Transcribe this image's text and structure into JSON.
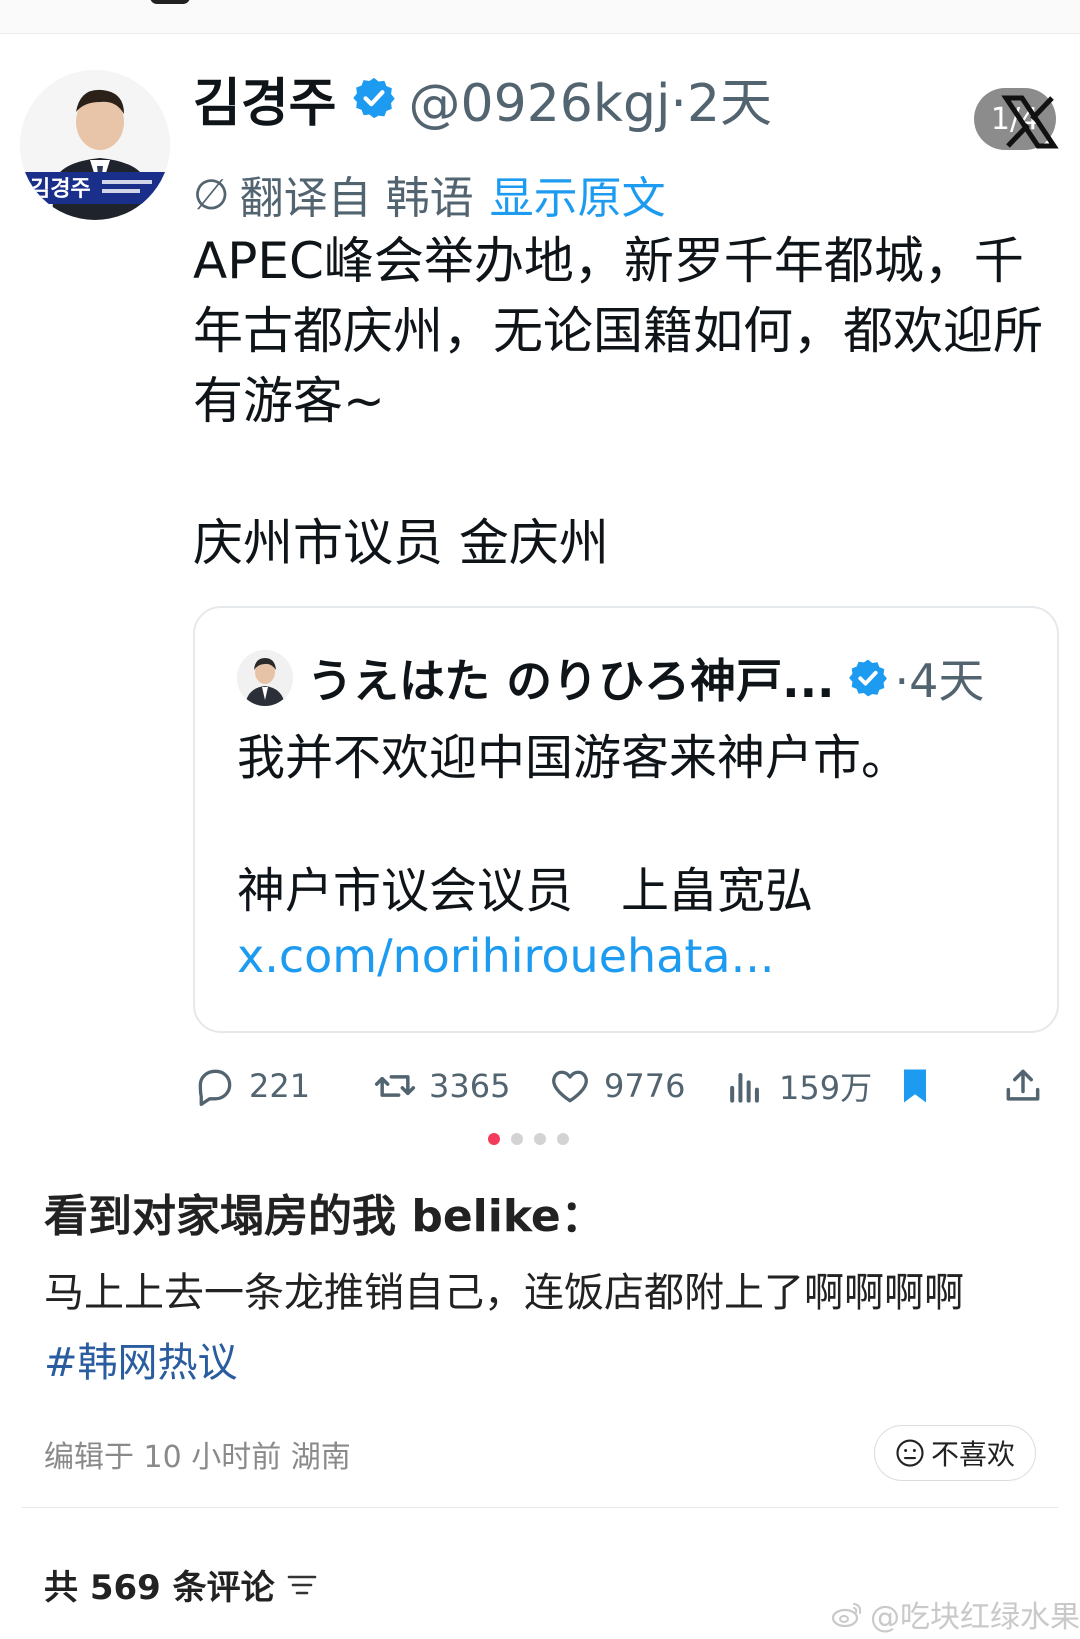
{
  "tweet": {
    "author_name": "김경주",
    "handle_time": "@0926kgj·2天",
    "page_counter": "1/4",
    "translate_label": "翻译自 韩语",
    "show_original": "显示原文",
    "body": "APEC峰会举办地，新罗千年都城，千年古都庆州，无论国籍如何，都欢迎所有游客~",
    "signature": "庆州市议员 金庆州",
    "avatar_caption": "김경주",
    "quote": {
      "author_name": "うえはた のりひろ神戸...",
      "time": "·4天",
      "text": "我并不欢迎中国游客来神户市。",
      "signature": "神户市议会议员　上畠宽弘",
      "link": "x.com/norihirouehata..."
    },
    "actions": {
      "replies": "221",
      "retweets": "3365",
      "likes": "9776",
      "views": "159万"
    }
  },
  "post": {
    "title": "看到对家塌房的我 belike：",
    "body": "马上上去一条龙推销自己，连饭店都附上了啊啊啊啊",
    "tag": "#韩网热议",
    "meta": "编辑于 10 小时前 湖南",
    "dislike_label": "不喜欢",
    "comment_count": "共 569 条评论"
  },
  "watermark": "@吃块红绿水果",
  "colors": {
    "x_blue": "#1d9bf0",
    "weibo_active_dot": "#f33b5b",
    "topic_blue": "#2a5d9f"
  },
  "icons": [
    "verified-badge-icon",
    "x-logo-icon",
    "reply-icon",
    "retweet-icon",
    "like-icon",
    "views-icon",
    "bookmark-icon",
    "share-icon",
    "dislike-face-icon",
    "sort-icon",
    "weibo-icon"
  ]
}
